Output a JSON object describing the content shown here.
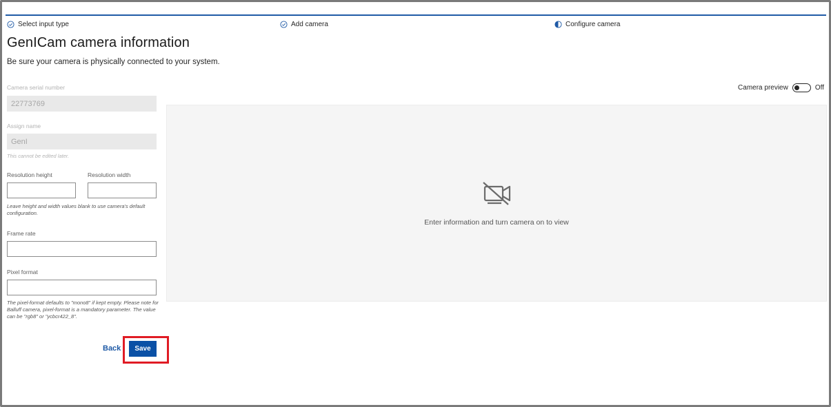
{
  "stepper": {
    "steps": [
      {
        "label": "Select input type",
        "state": "complete",
        "icon": "check-circle-icon"
      },
      {
        "label": "Add camera",
        "state": "complete",
        "icon": "check-circle-icon"
      },
      {
        "label": "Configure camera",
        "state": "in-progress",
        "icon": "half-circle-icon"
      }
    ],
    "accent_color": "#1f5aa6"
  },
  "page": {
    "title": "GenICam camera information",
    "subtitle": "Be sure your camera is physically connected to your system."
  },
  "form": {
    "serial": {
      "label": "Camera serial number",
      "value": "22773769",
      "disabled": true
    },
    "name": {
      "label": "Assign name",
      "value": "GenI",
      "disabled": true,
      "hint": "This cannot be edited later."
    },
    "resolution_height": {
      "label": "Resolution height",
      "value": "",
      "placeholder": ""
    },
    "resolution_width": {
      "label": "Resolution width",
      "value": "",
      "placeholder": ""
    },
    "resolution_hint": "Leave height and width values blank to use camera's default configuration.",
    "frame_rate": {
      "label": "Frame rate",
      "value": "",
      "placeholder": ""
    },
    "pixel_format": {
      "label": "Pixel format",
      "value": "",
      "placeholder": ""
    },
    "pixel_format_hint": "The pixel-format defaults to \"mono8\" if kept empty. Please note for Balluff camera, pixel-format is a mandatory parameter. The value can be \"rgb8\" or \"ycbcr422_8\"."
  },
  "actions": {
    "back_label": "Back",
    "save_label": "Save",
    "save_color": "#0b51a6"
  },
  "preview": {
    "toggle_label": "Camera preview",
    "toggle_state": "Off",
    "icon": "camera-off-icon",
    "message": "Enter information and turn camera on to view"
  }
}
